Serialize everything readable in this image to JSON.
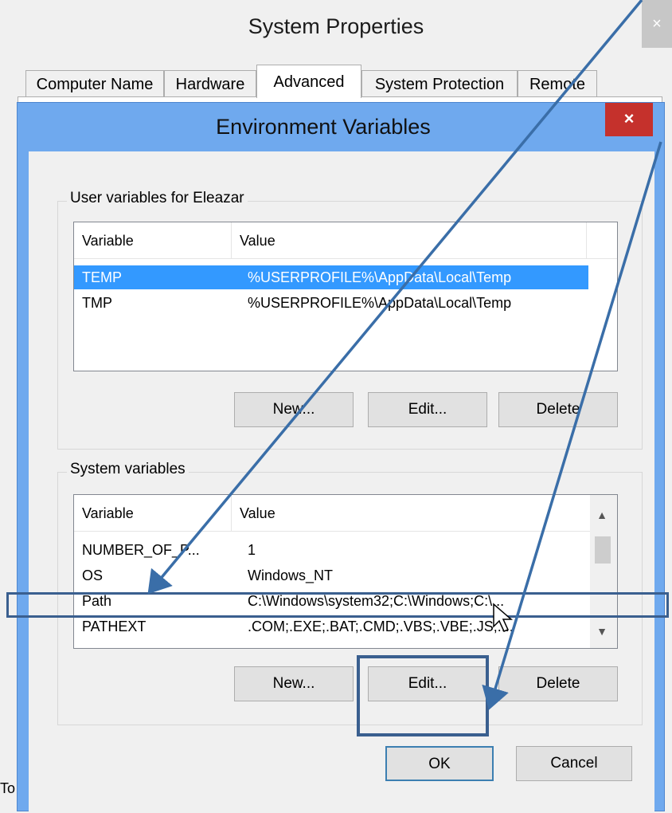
{
  "system_properties": {
    "title": "System Properties",
    "close_glyph": "×",
    "tabs": [
      {
        "label": "Computer Name"
      },
      {
        "label": "Hardware"
      },
      {
        "label": "Advanced"
      },
      {
        "label": "System Protection"
      },
      {
        "label": "Remote"
      }
    ],
    "active_tab": "Advanced",
    "partial_text": "To"
  },
  "env_dialog": {
    "title": "Environment Variables",
    "close_glyph": "×",
    "user_group": {
      "label": "User variables for Eleazar",
      "columns": [
        "Variable",
        "Value"
      ],
      "rows": [
        {
          "variable": "TEMP",
          "value": "%USERPROFILE%\\AppData\\Local\\Temp",
          "selected": true
        },
        {
          "variable": "TMP",
          "value": "%USERPROFILE%\\AppData\\Local\\Temp",
          "selected": false
        }
      ],
      "buttons": {
        "new": "New...",
        "edit": "Edit...",
        "delete": "Delete"
      }
    },
    "system_group": {
      "label": "System variables",
      "columns": [
        "Variable",
        "Value"
      ],
      "rows": [
        {
          "variable": "NUMBER_OF_P...",
          "value": "1"
        },
        {
          "variable": "OS",
          "value": "Windows_NT"
        },
        {
          "variable": "Path",
          "value": "C:\\Windows\\system32;C:\\Windows;C:\\..."
        },
        {
          "variable": "PATHEXT",
          "value": ".COM;.EXE;.BAT;.CMD;.VBS;.VBE;.JS;...."
        }
      ],
      "buttons": {
        "new": "New...",
        "edit": "Edit...",
        "delete": "Delete"
      }
    },
    "ok_label": "OK",
    "cancel_label": "Cancel"
  },
  "colors": {
    "dialog_frame": "#6fa9ee",
    "close_button": "#c5312c",
    "selection": "#3399ff",
    "annotation": "#3a6ea8"
  },
  "icons": [
    "close-icon",
    "scroll-up-arrow-icon",
    "scroll-down-arrow-icon",
    "mouse-cursor-icon",
    "annotation-arrow-icon"
  ]
}
